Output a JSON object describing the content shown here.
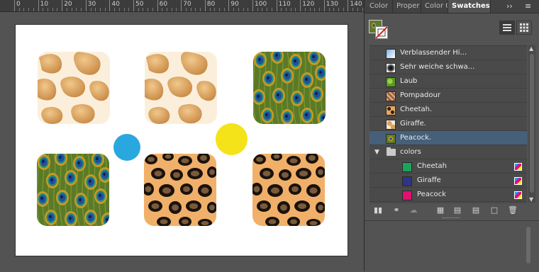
{
  "ruler": {
    "labels": [
      "0",
      "10",
      "20",
      "30",
      "40",
      "50",
      "60",
      "70",
      "80",
      "90",
      "100",
      "110",
      "120",
      "130",
      "140"
    ]
  },
  "artboard": {
    "tiles": [
      {
        "pattern": "giraffe"
      },
      {
        "pattern": "giraffe"
      },
      {
        "pattern": "peacock"
      },
      {
        "pattern": "peacock"
      },
      {
        "pattern": "cheetah"
      },
      {
        "pattern": "cheetah"
      }
    ],
    "dots": [
      {
        "color": "#29a8e0"
      },
      {
        "color": "#f5e31a"
      }
    ]
  },
  "panel": {
    "tabs": [
      "Color",
      "Proper",
      "Color G",
      "Swatches"
    ],
    "active_tab": "Swatches",
    "more_tabs": "››",
    "menu": "≡",
    "view_list_icon": "list-view-icon",
    "view_grid_icon": "grid-view-icon",
    "swatches": [
      {
        "label": "Verblassender Hi...",
        "thumb": "fade"
      },
      {
        "label": "Sehr weiche schwa...",
        "thumb": "softblack"
      },
      {
        "label": "Laub",
        "thumb": "leaf"
      },
      {
        "label": "Pompadour",
        "thumb": "pompadour"
      },
      {
        "label": "Cheetah.",
        "thumb": "cheetah"
      },
      {
        "label": "Giraffe.",
        "thumb": "giraffe"
      },
      {
        "label": "Peacock.",
        "thumb": "peacock",
        "selected": true
      }
    ],
    "group": {
      "label": "colors",
      "items": [
        {
          "label": "Cheetah",
          "color": "#1aa35a"
        },
        {
          "label": "Giraffe",
          "color": "#2e3585"
        },
        {
          "label": "Peacock",
          "color": "#e0106e"
        }
      ]
    },
    "footer_icons": [
      "swatch-libraries-icon",
      "place-swatch-icon",
      "cloud-icon",
      "show-kinds-icon",
      "swatch-options-icon",
      "new-color-group-icon",
      "new-swatch-icon",
      "delete-swatch-icon"
    ]
  }
}
